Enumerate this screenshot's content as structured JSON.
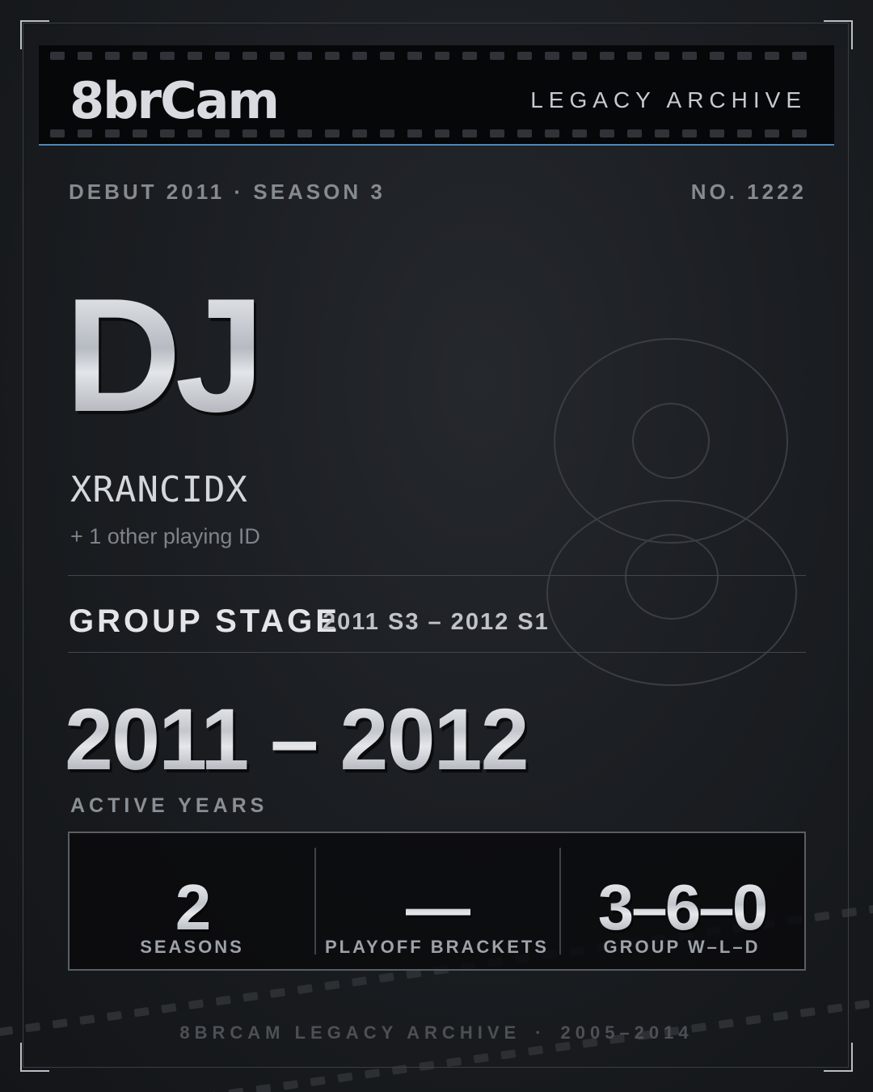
{
  "header": {
    "logo": "8brCam",
    "subtitle": "LEGACY ARCHIVE"
  },
  "meta": {
    "debut": "DEBUT 2011 · SEASON 3",
    "number": "NO. 1222"
  },
  "player": {
    "initials": "DJ",
    "name": "XRANCIDX",
    "other_ids": "+ 1 other playing ID",
    "watermark_digit": "8"
  },
  "stage": {
    "title": "GROUP STAGE",
    "range": "2011 S3 – 2012 S1"
  },
  "active": {
    "years": "2011 – 2012",
    "label": "ACTIVE YEARS"
  },
  "stats": [
    {
      "value": "2",
      "label": "SEASONS"
    },
    {
      "value": "—",
      "label": "PLAYOFF BRACKETS"
    },
    {
      "value": "3–6–0",
      "label": "GROUP W–L–D"
    }
  ],
  "footer": {
    "left": "8BRCAM LEGACY ARCHIVE",
    "separator": "·",
    "right": "2005–2014"
  },
  "colors": {
    "accent": "#4f86b8",
    "background": "#15181c"
  }
}
